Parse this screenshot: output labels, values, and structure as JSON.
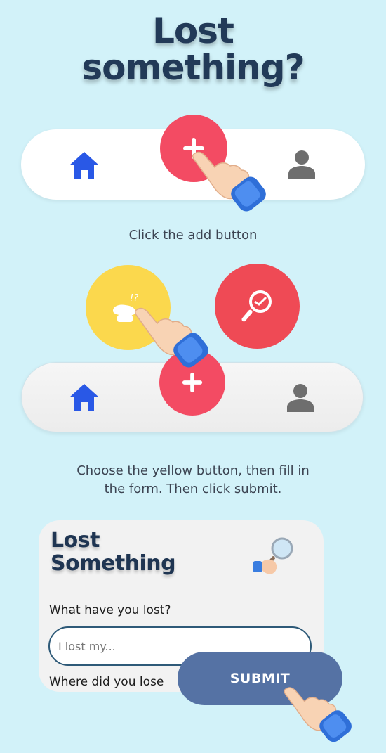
{
  "header": {
    "title_line1": "Lost",
    "title_line2": "something?"
  },
  "step1": {
    "caption": "Click the add button"
  },
  "step2": {
    "caption_line1": "Choose the yellow button, then fill in",
    "caption_line2": "the form. Then click submit."
  },
  "form": {
    "title_line1": "Lost",
    "title_line2": "Something",
    "lost_label": "What have you lost?",
    "lost_placeholder": "I lost my...",
    "where_label": "Where did you lose",
    "submit_label": "SUBMIT"
  },
  "icons": {
    "home": "home-icon",
    "user": "user-icon",
    "add": "plus-icon",
    "lost_item": "lost-item-icon",
    "found_search": "search-icon",
    "pointer_hand": "pointing-hand-icon",
    "magnifier_hand": "magnifier-hand-icon"
  },
  "colors": {
    "background": "#d2f2f9",
    "title": "#223a58",
    "add_button": "#f34b63",
    "lost_button": "#fbd84d",
    "found_button": "#ef4a55",
    "home_icon": "#2958e6",
    "user_icon": "#6e6e6e",
    "submit_button": "#5572a4"
  }
}
